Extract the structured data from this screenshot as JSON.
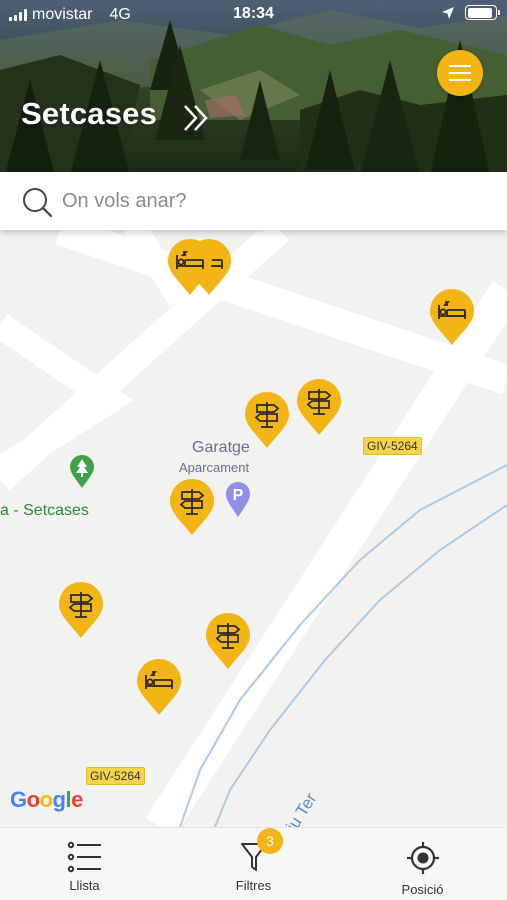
{
  "status_bar": {
    "carrier": "movistar",
    "network": "4G",
    "time": "18:34",
    "battery_level": 0.9
  },
  "header": {
    "title": "Setcases",
    "menu_icon": "hamburger-icon",
    "accent": "#f3b514"
  },
  "search": {
    "placeholder": "On vols anar?"
  },
  "map": {
    "labels": {
      "garatge": "Garatge",
      "aparcament": "Aparcament",
      "setcases": "a - Setcases",
      "river": "Riu Ter",
      "road_1": "GIV-5264",
      "road_2": "GIV-5264",
      "google": "Google"
    },
    "pins": [
      {
        "type": "lodging",
        "icon": "bed-icon"
      },
      {
        "type": "lodging",
        "icon": "bed-icon"
      },
      {
        "type": "lodging",
        "icon": "bed-icon"
      },
      {
        "type": "signpost",
        "icon": "signpost-icon"
      },
      {
        "type": "signpost",
        "icon": "signpost-icon"
      },
      {
        "type": "signpost",
        "icon": "signpost-icon"
      },
      {
        "type": "signpost",
        "icon": "signpost-icon"
      },
      {
        "type": "signpost",
        "icon": "signpost-icon"
      },
      {
        "type": "lodging",
        "icon": "bed-icon"
      }
    ]
  },
  "tabbar": {
    "items": [
      {
        "label": "Llista",
        "icon": "list-icon"
      },
      {
        "label": "Filtres",
        "icon": "filter-icon",
        "badge": "3"
      },
      {
        "label": "Posició",
        "icon": "crosshair-icon"
      }
    ]
  }
}
